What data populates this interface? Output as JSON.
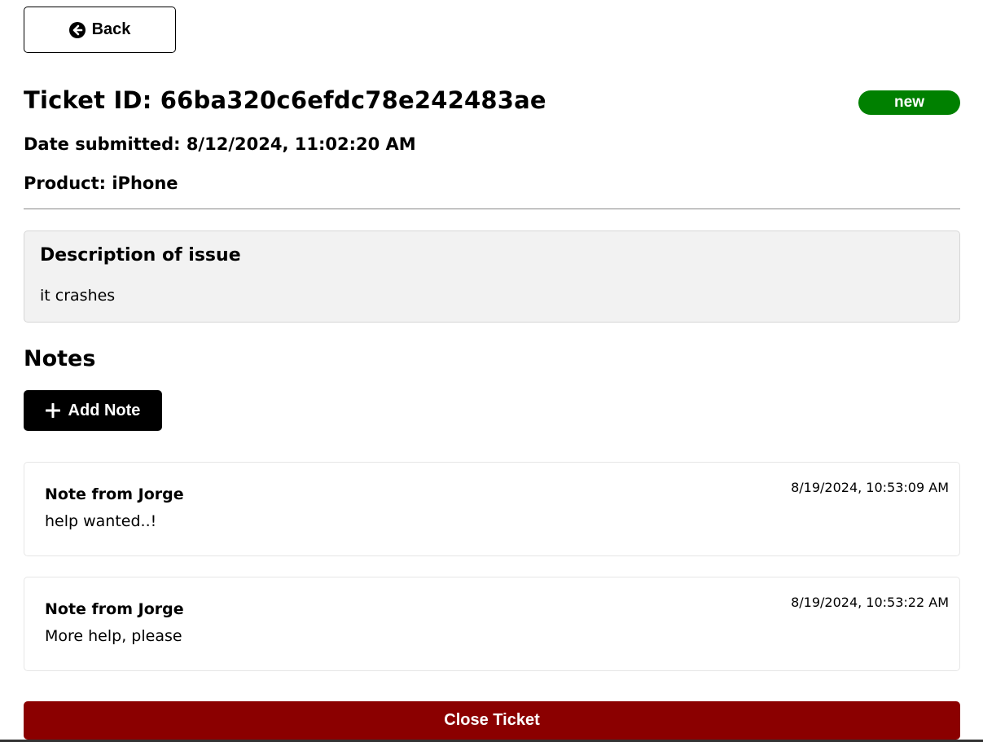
{
  "back_button": {
    "label": "Back",
    "icon": "arrow-circle-left-icon"
  },
  "ticket": {
    "title": "Ticket ID: 66ba320c6efdc78e242483ae",
    "status": "new",
    "status_color": "#008000",
    "date_submitted": "Date submitted: 8/12/2024, 11:02:20 AM",
    "product": "Product: iPhone"
  },
  "description": {
    "heading": "Description of issue",
    "text": "it crashes"
  },
  "notes": {
    "heading": "Notes",
    "add_button_label": "Add Note",
    "add_button_icon": "plus-icon",
    "items": [
      {
        "author": "Note from Jorge",
        "text": "help wanted..!",
        "date": "8/19/2024, 10:53:09 AM"
      },
      {
        "author": "Note from Jorge",
        "text": "More help, please",
        "date": "8/19/2024, 10:53:22 AM"
      }
    ]
  },
  "close_button": {
    "label": "Close Ticket",
    "color": "#8b0000"
  }
}
